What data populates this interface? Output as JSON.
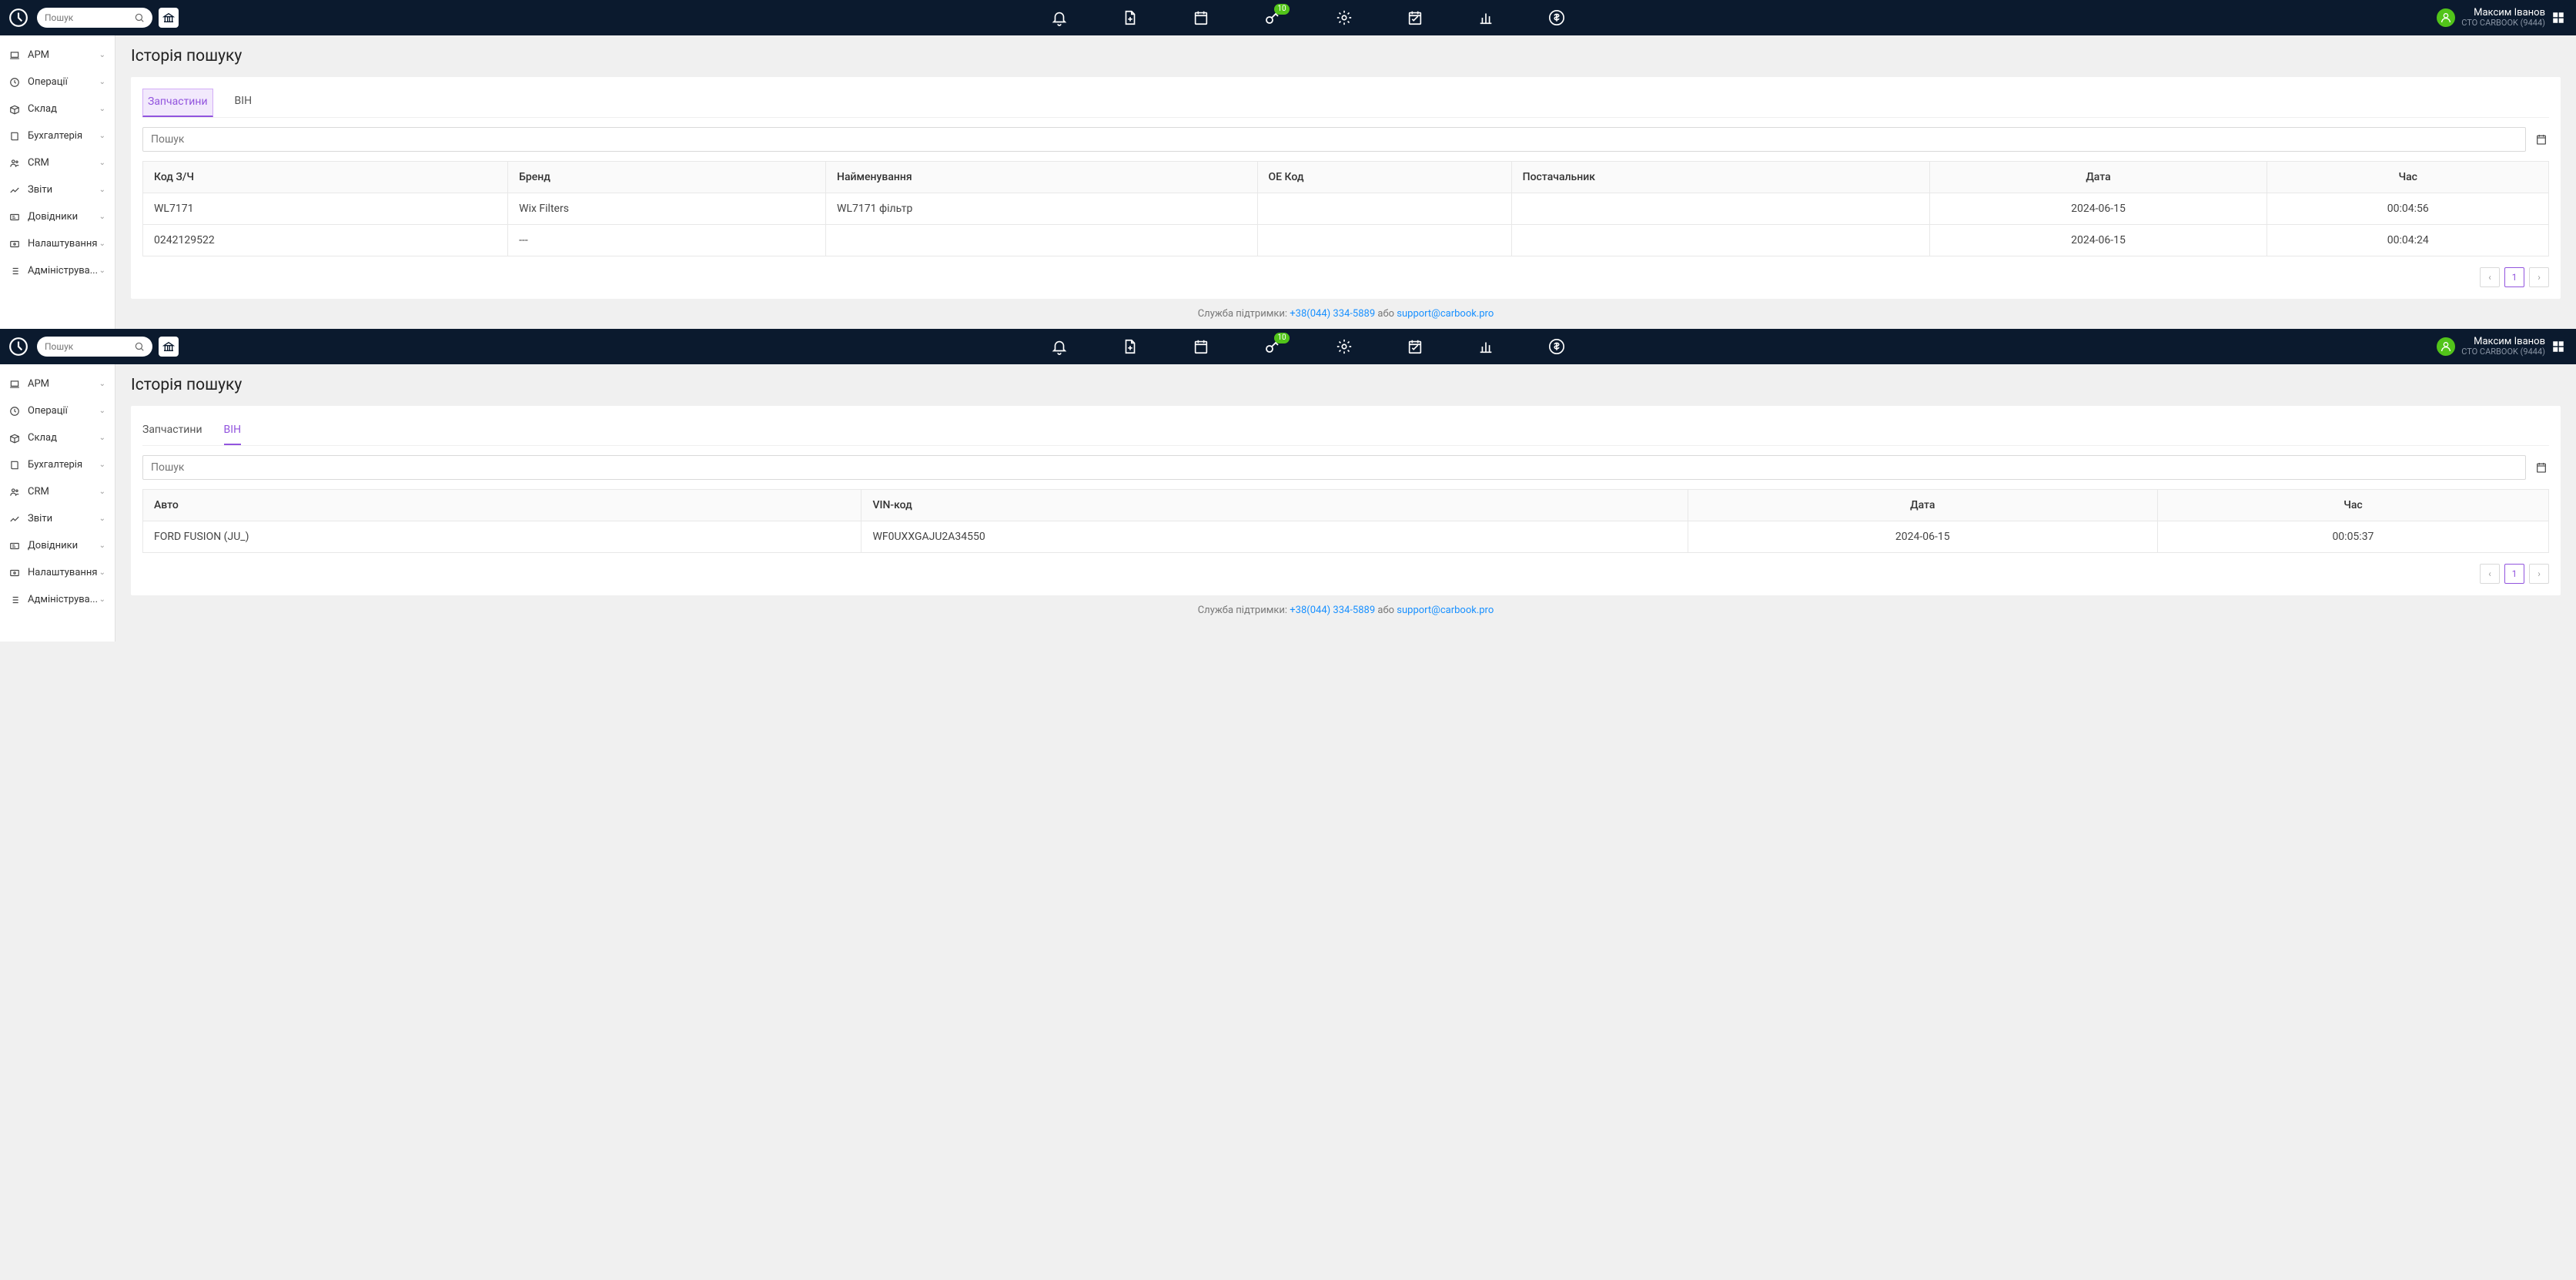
{
  "header": {
    "search_placeholder": "Пошук",
    "badge_count": "10",
    "user_name": "Максим Іванов",
    "org_name": "СТО CARBOOK (9444)"
  },
  "sidebar": {
    "items": [
      {
        "label": "АРМ"
      },
      {
        "label": "Операції"
      },
      {
        "label": "Склад"
      },
      {
        "label": "Бухгалтерія"
      },
      {
        "label": "CRM"
      },
      {
        "label": "Звіти"
      },
      {
        "label": "Довідники"
      },
      {
        "label": "Налаштування"
      },
      {
        "label": "Адмініструва..."
      }
    ]
  },
  "page_title": "Історія пошуку",
  "tabs": {
    "parts_label": "Запчастини",
    "vin_label": "ВІН"
  },
  "table_search_placeholder": "Пошук",
  "parts_table": {
    "headers": {
      "code": "Код З/Ч",
      "brand": "Бренд",
      "name": "Найменування",
      "oe": "OE Код",
      "supplier": "Постачальник",
      "date": "Дата",
      "time": "Час"
    },
    "rows": [
      {
        "code": "WL7171",
        "brand": "Wix Filters",
        "name": "WL7171 фільтр",
        "oe": "",
        "supplier": "",
        "date": "2024-06-15",
        "time": "00:04:56"
      },
      {
        "code": "0242129522",
        "brand": "---",
        "name": "",
        "oe": "",
        "supplier": "",
        "date": "2024-06-15",
        "time": "00:04:24"
      }
    ]
  },
  "vin_table": {
    "headers": {
      "auto": "Авто",
      "vin": "VIN-код",
      "date": "Дата",
      "time": "Час"
    },
    "rows": [
      {
        "auto": "FORD FUSION (JU_)",
        "vin": "WF0UXXGAJU2A34550",
        "date": "2024-06-15",
        "time": "00:05:37"
      }
    ]
  },
  "pagination": {
    "current": "1"
  },
  "footer": {
    "support_label": "Служба підтримки:",
    "phone": "+38(044) 334-5889",
    "or": "або",
    "email": "support@carbook.pro"
  }
}
